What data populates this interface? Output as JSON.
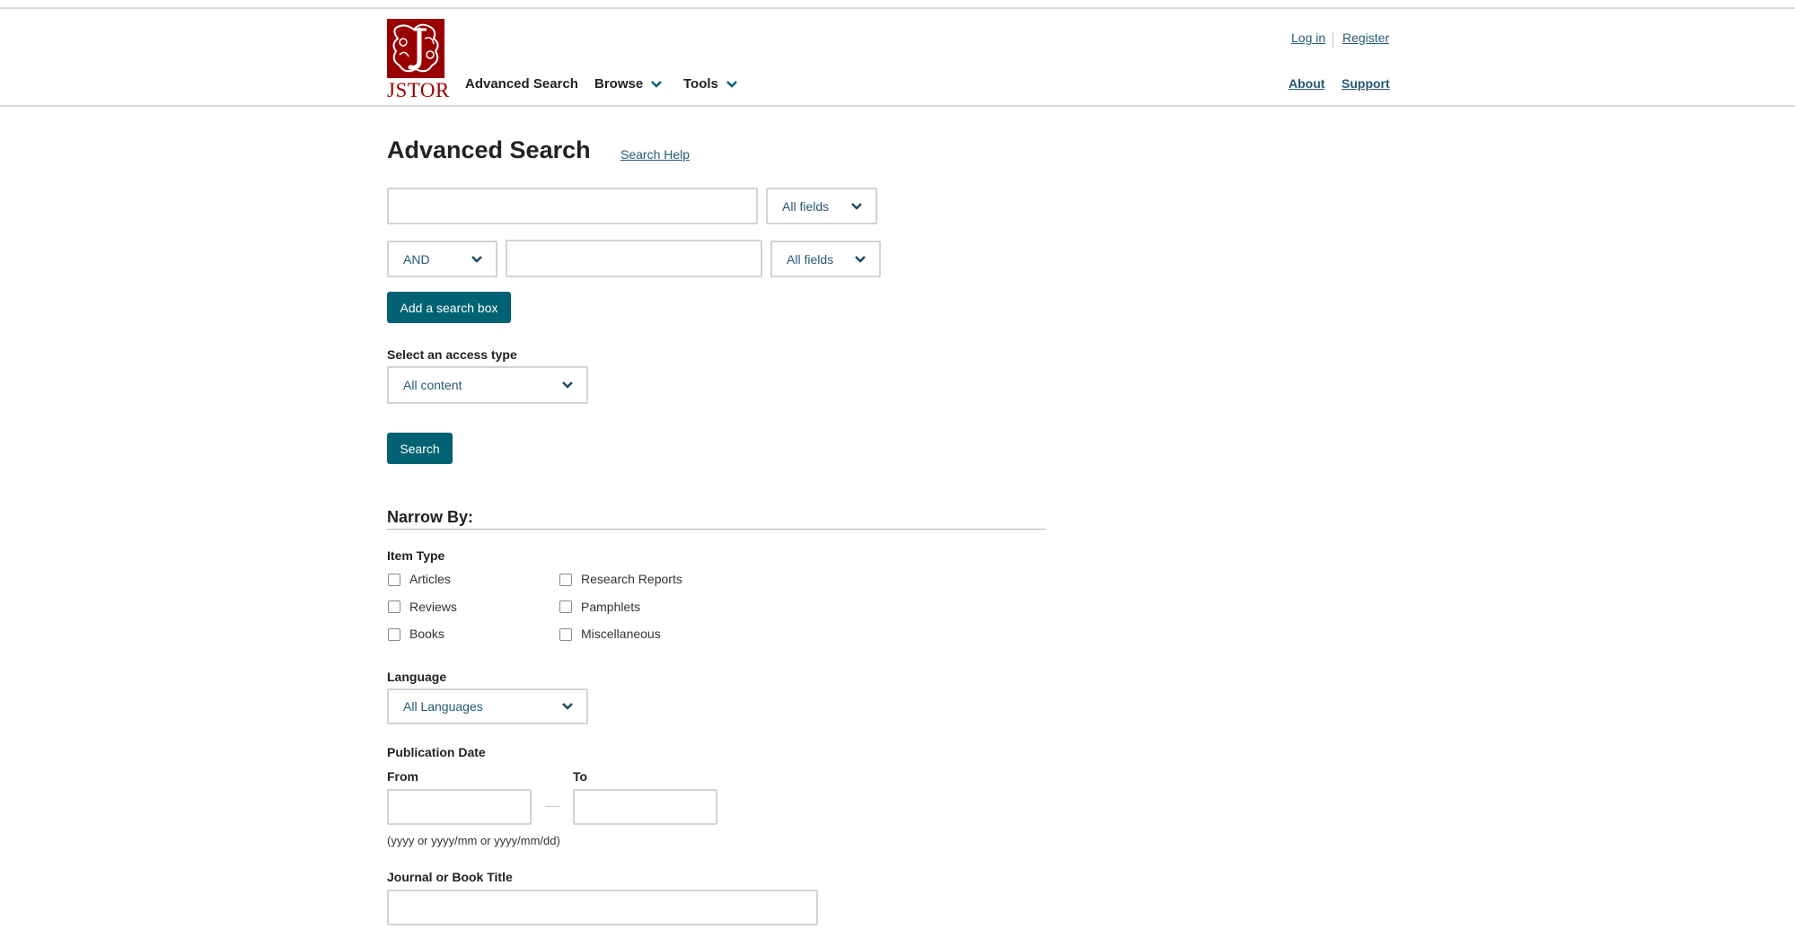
{
  "brand": {
    "logo_text": "JSTOR"
  },
  "nav": {
    "advanced_search": "Advanced Search",
    "browse": "Browse",
    "tools": "Tools"
  },
  "account": {
    "login": "Log in",
    "register": "Register"
  },
  "secondary_links": {
    "about": "About",
    "support": "Support"
  },
  "page": {
    "title": "Advanced Search",
    "help_link": "Search Help"
  },
  "search": {
    "row1": {
      "query": "",
      "field": "All fields"
    },
    "row2": {
      "operator": "AND",
      "query": "",
      "field": "All fields"
    },
    "add_box_label": "Add a search box"
  },
  "access": {
    "label": "Select an access type",
    "value": "All content"
  },
  "search_button": "Search",
  "narrow_by": {
    "title": "Narrow By:",
    "item_type": {
      "label": "Item Type",
      "options": [
        "Articles",
        "Reviews",
        "Books",
        "Research Reports",
        "Pamphlets",
        "Miscellaneous"
      ],
      "checked": [
        false,
        false,
        false,
        false,
        false,
        false
      ]
    },
    "language": {
      "label": "Language",
      "value": "All Languages"
    },
    "publication_date": {
      "label": "Publication Date",
      "from_label": "From",
      "to_label": "To",
      "from_value": "",
      "to_value": "",
      "hint": "(yyyy or yyyy/mm or yyyy/mm/dd)"
    },
    "journal_title": {
      "label": "Journal or Book Title",
      "value": ""
    }
  },
  "colors": {
    "accent": "#006272",
    "link": "#245a75",
    "brand": "#990000"
  }
}
